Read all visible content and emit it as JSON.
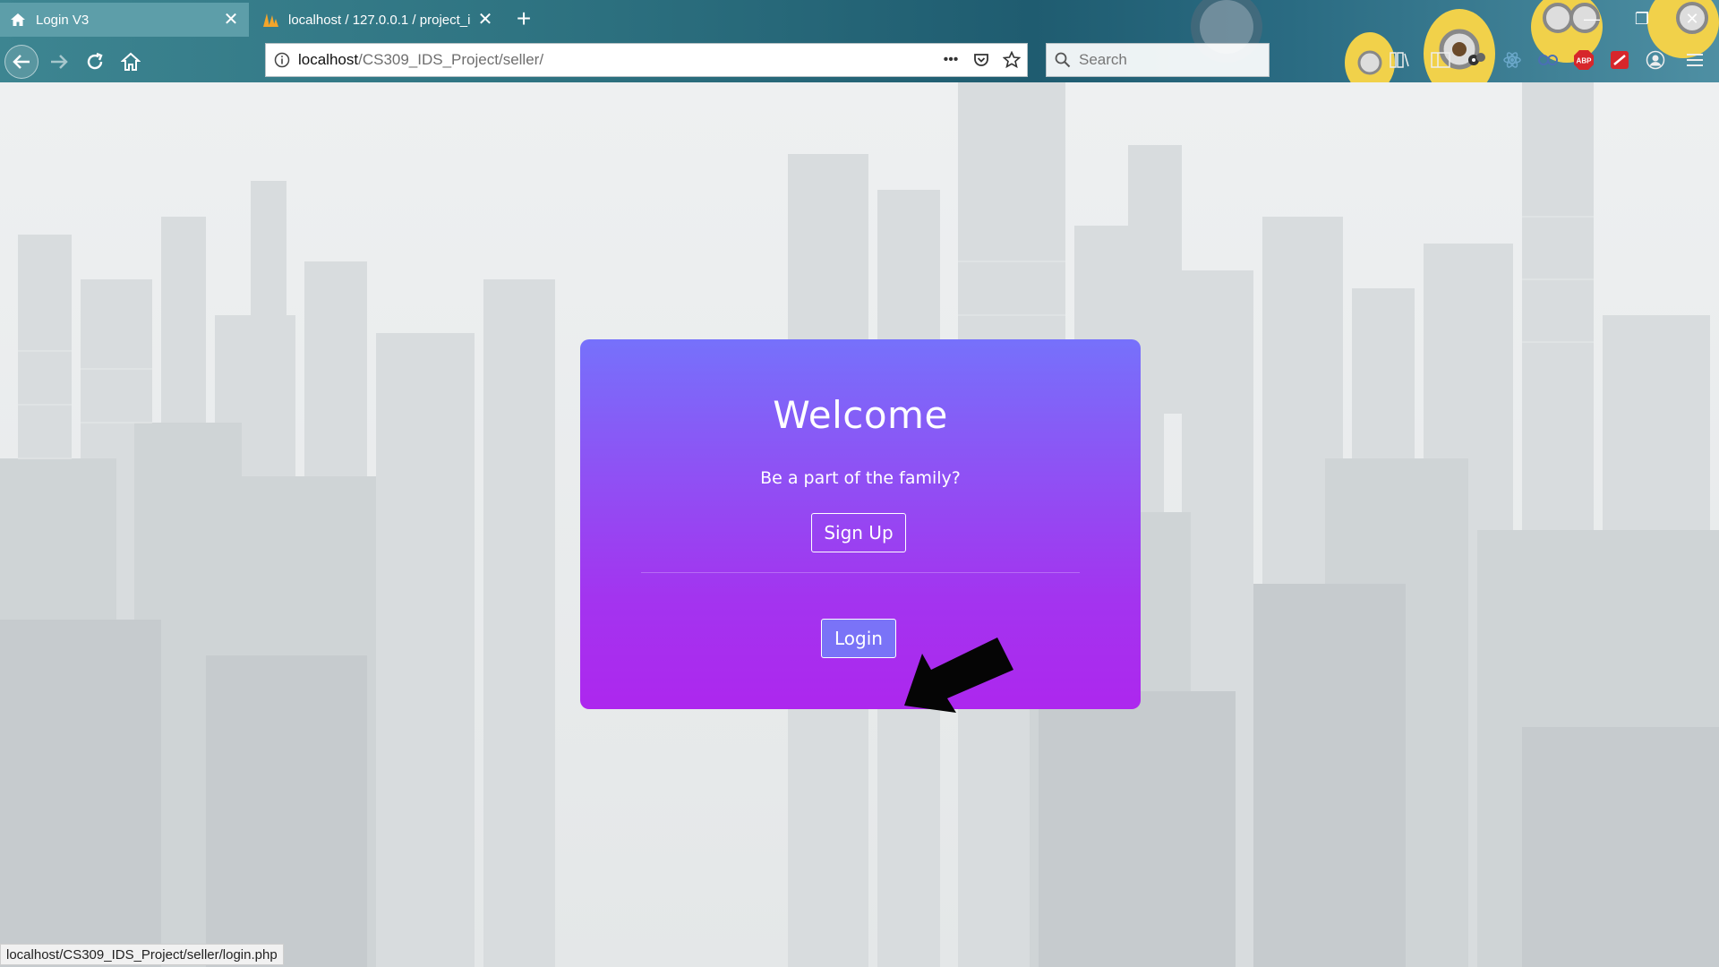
{
  "browser": {
    "tabs": [
      {
        "title": "Login V3",
        "active": true,
        "icon": "home-icon"
      },
      {
        "title": "localhost / 127.0.0.1 / project_i",
        "active": false,
        "icon": "phpmyadmin-icon"
      }
    ],
    "new_tab_label": "+",
    "address": {
      "host": "localhost",
      "path": "/CS309_IDS_Project/seller/"
    },
    "search_placeholder": "Search",
    "status_url": "localhost/CS309_IDS_Project/seller/login.php",
    "toolbar_icons": [
      "reading-list-icon",
      "sidebar-icon",
      "extension-eye-icon",
      "atom-extension-icon",
      "glasses-extension-icon",
      "adblock-icon",
      "pdf-extension-icon",
      "account-icon",
      "menu-icon"
    ],
    "abp_label": "ABP"
  },
  "card": {
    "title": "Welcome",
    "subtitle": "Be a part of the family?",
    "signup_label": "Sign Up",
    "login_label": "Login"
  },
  "colors": {
    "card_top": "#7671fb",
    "card_bottom": "#ad27ee",
    "login_button": "#7a73f7",
    "chrome": "#2f7482"
  }
}
